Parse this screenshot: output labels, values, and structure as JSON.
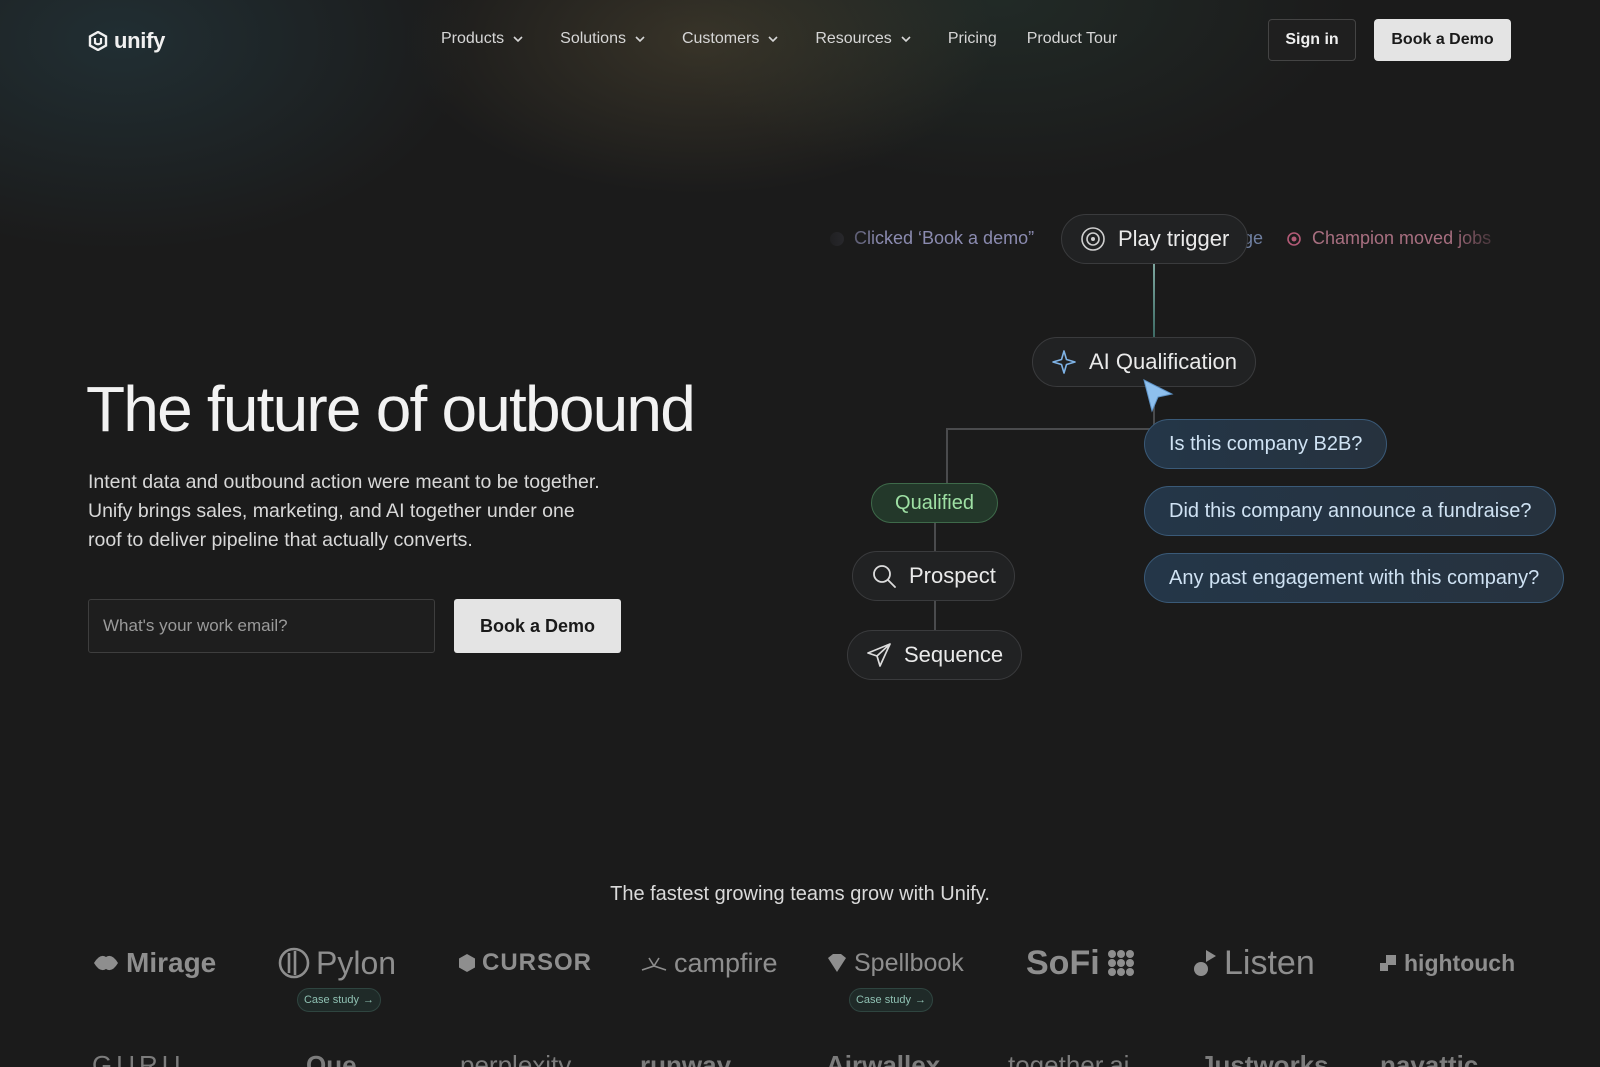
{
  "nav": {
    "logo": "unify",
    "links": [
      {
        "label": "Products",
        "dropdown": true
      },
      {
        "label": "Solutions",
        "dropdown": true
      },
      {
        "label": "Customers",
        "dropdown": true
      },
      {
        "label": "Resources",
        "dropdown": true
      },
      {
        "label": "Pricing",
        "dropdown": false
      },
      {
        "label": "Product Tour",
        "dropdown": false
      }
    ],
    "sign_in": "Sign in",
    "book_demo": "Book a Demo"
  },
  "hero": {
    "title": "The future of outbound",
    "subtitle": "Intent data and outbound action were meant to be together. Unify brings sales, marketing, and AI together under one roof to deliver pipeline that actually converts.",
    "email_placeholder": "What's your work email?",
    "cta": "Book a Demo"
  },
  "diagram": {
    "ticker": [
      {
        "text": "Clicked ‘Book a demo”",
        "color": "#8b8bb0",
        "dot": "#3a3a44"
      },
      {
        "text": "ge",
        "color": "#6f7fa0",
        "dot": ""
      },
      {
        "text": "Champion moved jobs",
        "color": "#a86f80",
        "dot": "#b25a76"
      }
    ],
    "play_trigger": "Play trigger",
    "ai_qualification": "AI Qualification",
    "qualified": "Qualified",
    "prospect": "Prospect",
    "sequence": "Sequence",
    "questions": [
      "Is this company B2B?",
      "Did this company announce a fundraise?",
      "Any past engagement with this company?"
    ],
    "colors": {
      "accent_blue": "#7fb3e6",
      "qualified_green": "#9ee0a4"
    }
  },
  "logos": {
    "heading": "The fastest growing teams grow with Unify.",
    "row1": [
      "Mirage",
      "Pylon",
      "CURSOR",
      "campfire",
      "Spellbook",
      "SoFi",
      "Listen",
      "hightouch"
    ],
    "case_study": "Case study",
    "row2": [
      "GURU",
      "Que",
      "perplexity",
      "runway",
      "Airwallex",
      "together.ai",
      "Justworks",
      "navattic"
    ]
  }
}
